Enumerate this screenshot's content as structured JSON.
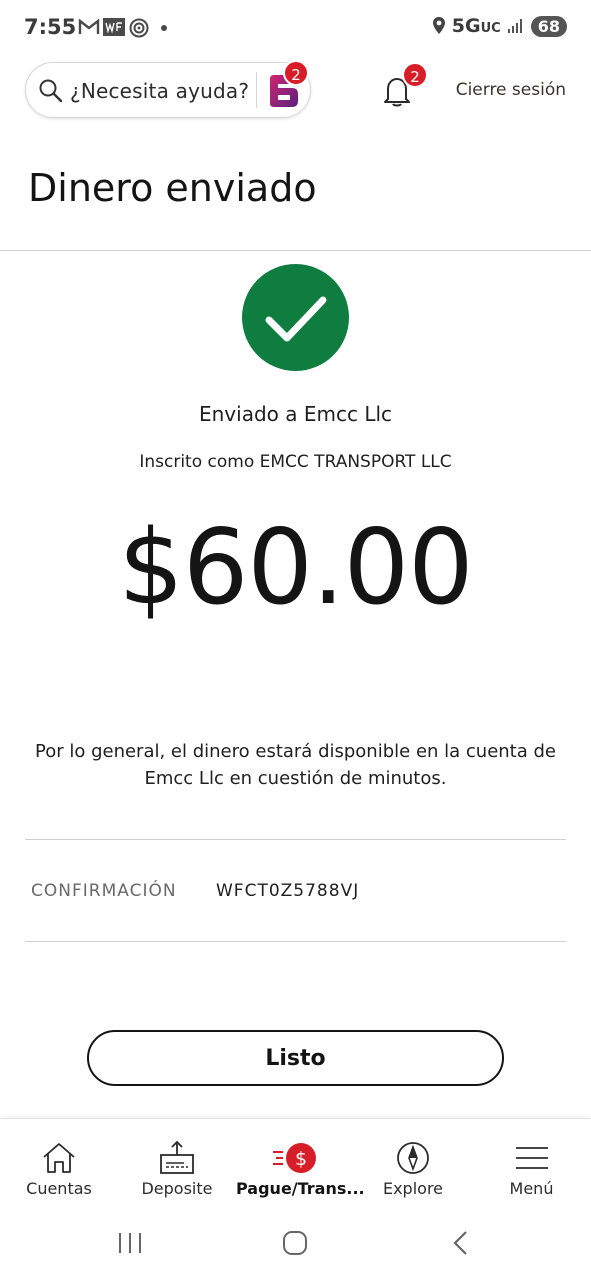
{
  "status_bar": {
    "time": "7:55",
    "network": "5G",
    "network_sub": "UC",
    "battery": "68"
  },
  "header": {
    "search_placeholder": "¿Necesita ayuda?",
    "assistant_badge": "2",
    "notifications_badge": "2",
    "logout_label": "Cierre sesión"
  },
  "page": {
    "title": "Dinero enviado",
    "sent_to": "Enviado a Emcc Llc",
    "enrolled_as": "Inscrito como EMCC TRANSPORT LLC",
    "amount": "$60.00",
    "availability_note": "Por lo general, el dinero estará disponible en la cuenta de Emcc Llc en cuestión de minutos.",
    "confirmation_label": "CONFIRMACIÓN",
    "confirmation_value": "WFCT0Z5788VJ",
    "done_label": "Listo",
    "success_color": "#0f7c40"
  },
  "bottom_nav": {
    "items": [
      {
        "label": "Cuentas",
        "icon": "home-icon"
      },
      {
        "label": "Deposite",
        "icon": "deposit-icon"
      },
      {
        "label": "Pague/Trans...",
        "icon": "pay-transfer-icon",
        "active": true
      },
      {
        "label": "Explore",
        "icon": "compass-icon"
      },
      {
        "label": "Menú",
        "icon": "menu-icon"
      }
    ]
  },
  "colors": {
    "brand_red": "#d71e28",
    "text": "#141414"
  }
}
